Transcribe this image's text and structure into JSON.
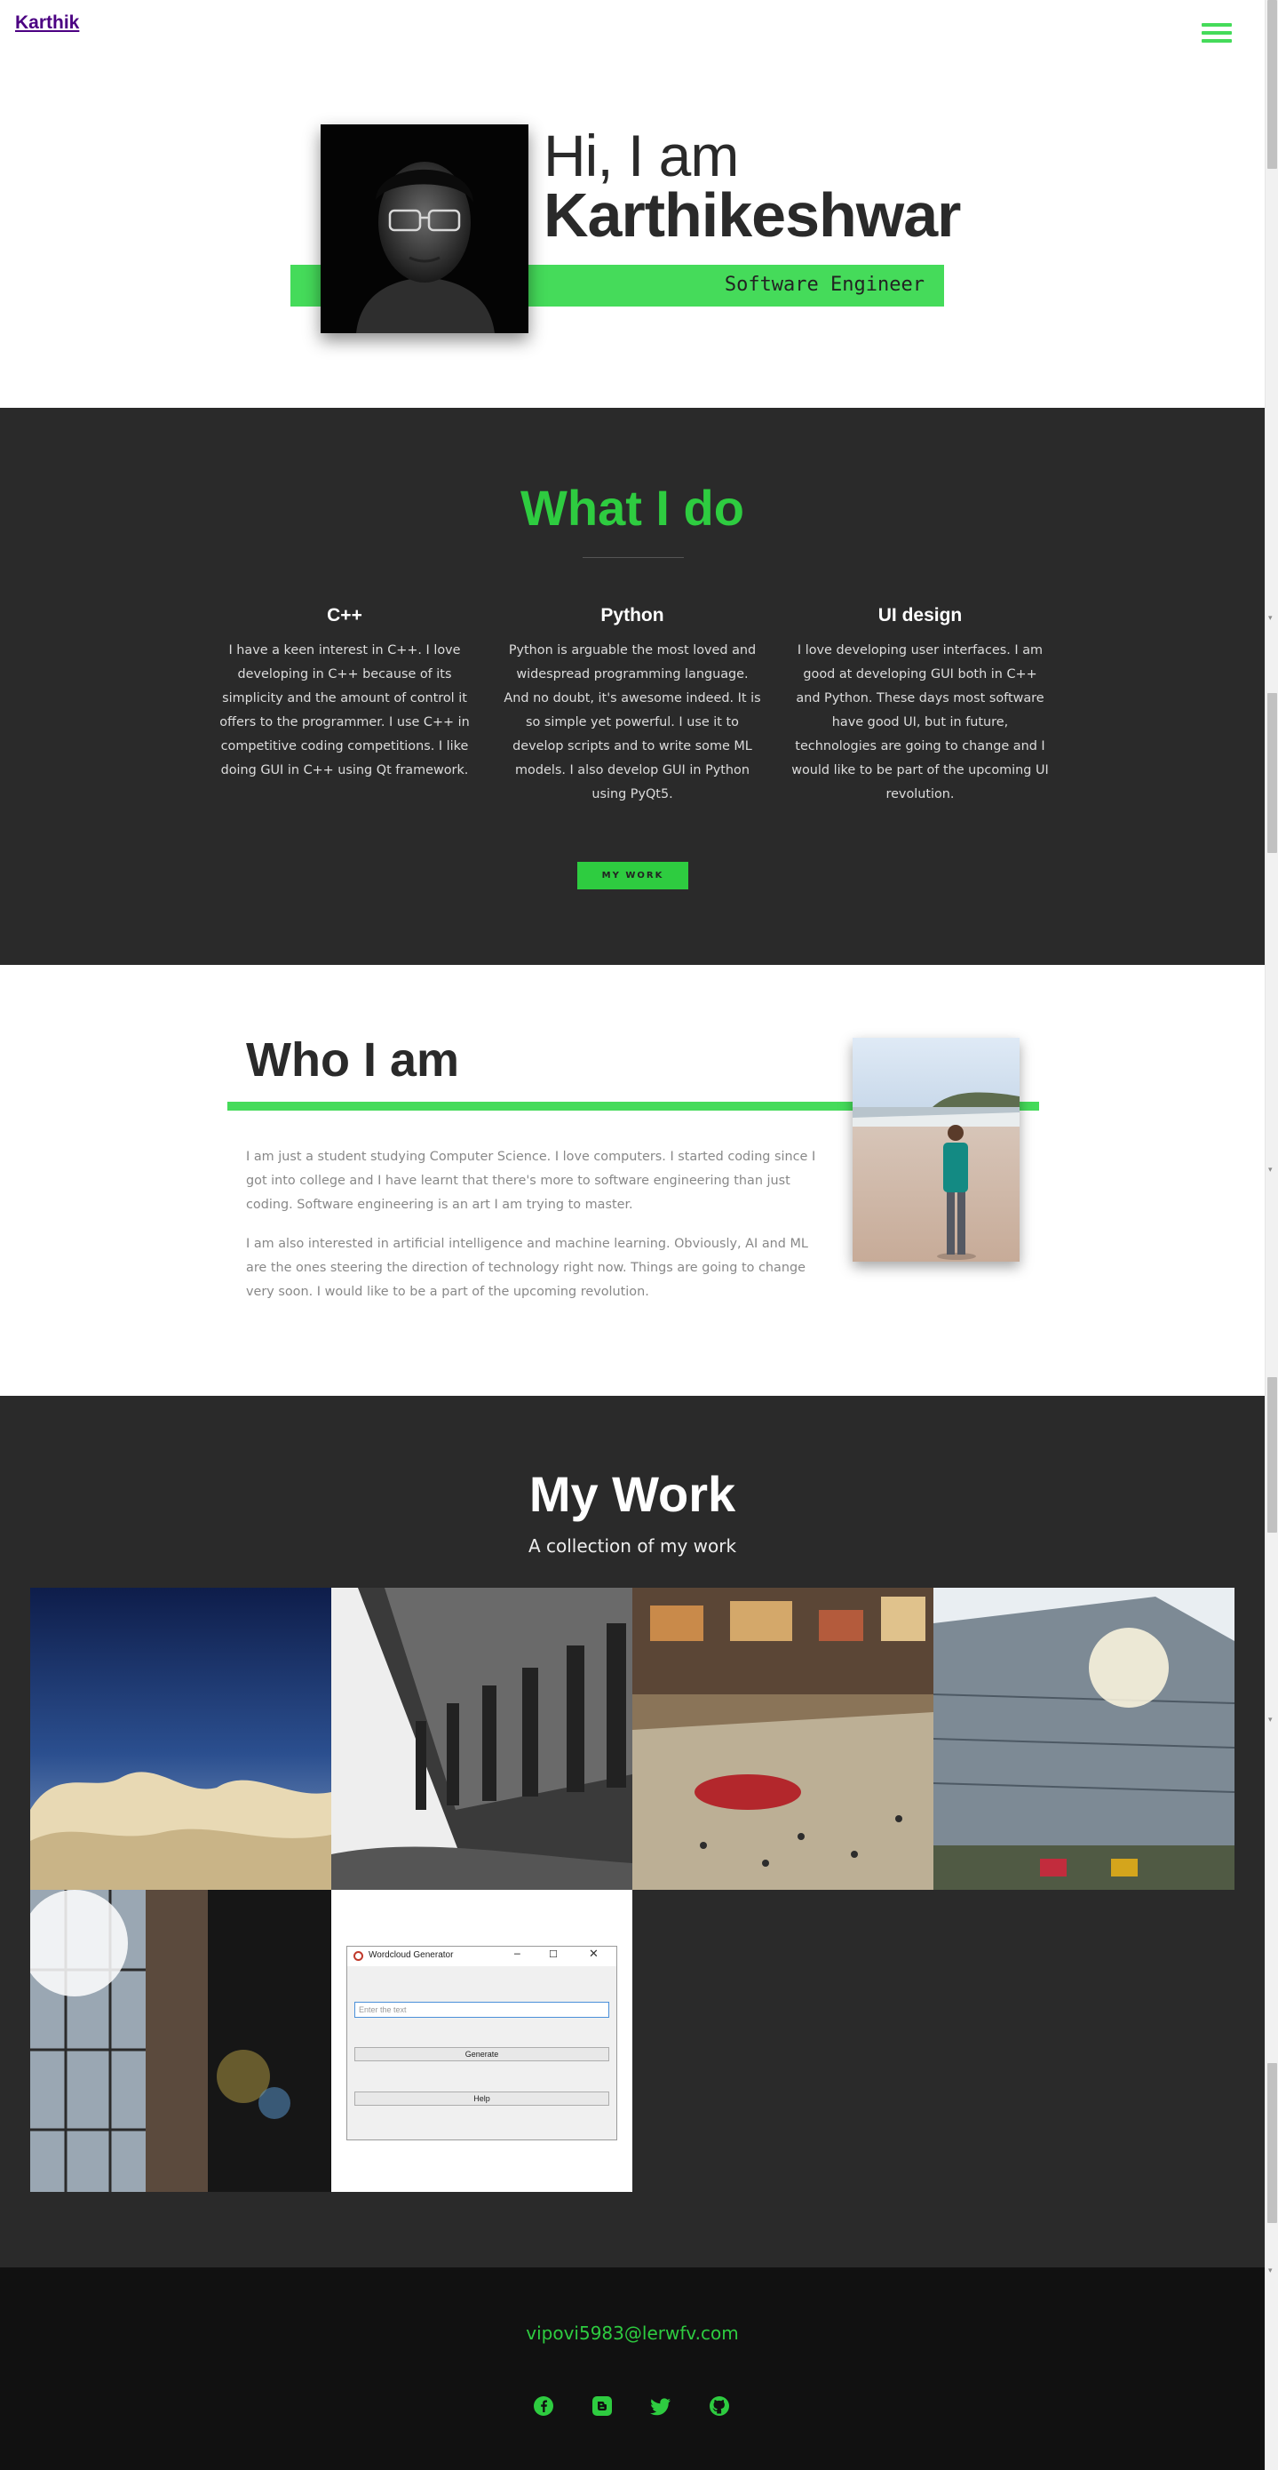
{
  "header": {
    "brand": "Karthik",
    "menu_icon": "hamburger-menu-icon"
  },
  "hero": {
    "greeting": "Hi, I am",
    "name": "Karthikeshwar",
    "role": "Software Engineer"
  },
  "what_i_do": {
    "title": "What I do",
    "columns": [
      {
        "heading": "C++",
        "text": "I have a keen interest in C++. I love developing in C++ because of its simplicity and the amount of control it offers to the programmer. I use C++ in competitive coding competitions. I like doing GUI in C++ using Qt framework."
      },
      {
        "heading": "Python",
        "text": "Python is arguable the most loved and widespread programming language. And no doubt, it's awesome indeed. It is so simple yet powerful. I use it to develop scripts and to write some ML models. I also develop GUI in Python using PyQt5."
      },
      {
        "heading": "UI design",
        "text": "I love developing user interfaces. I am good at developing GUI both in C++ and Python. These days most software have good UI, but in future, technologies are going to change and I would like to be part of the upcoming UI revolution."
      }
    ],
    "button": "MY WORK"
  },
  "who_i_am": {
    "title": "Who I am",
    "paragraphs": [
      "I am just a student studying Computer Science. I love computers. I started coding since I got into college and I have learnt that there's more to software engineering than just coding. Software engineering is an art I am trying to master.",
      "I am also interested in artificial intelligence and machine learning. Obviously, AI and ML are the ones steering the direction of technology right now. Things are going to change very soon. I would like to be a part of the upcoming revolution."
    ]
  },
  "my_work": {
    "title": "My Work",
    "subtitle": "A collection of my work",
    "wordcloud_app": {
      "window_title": "Wordcloud Generator",
      "placeholder": "Enter the text",
      "generate_label": "Generate",
      "help_label": "Help"
    }
  },
  "footer": {
    "email": "vipovi5983@lerwfv.com",
    "social_icons": [
      "facebook-icon",
      "blogger-icon",
      "twitter-icon",
      "github-icon"
    ]
  },
  "colors": {
    "accent": "#45db5a",
    "dark": "#2a2a2a",
    "footer": "#111111",
    "brand_link": "#4b0082"
  }
}
